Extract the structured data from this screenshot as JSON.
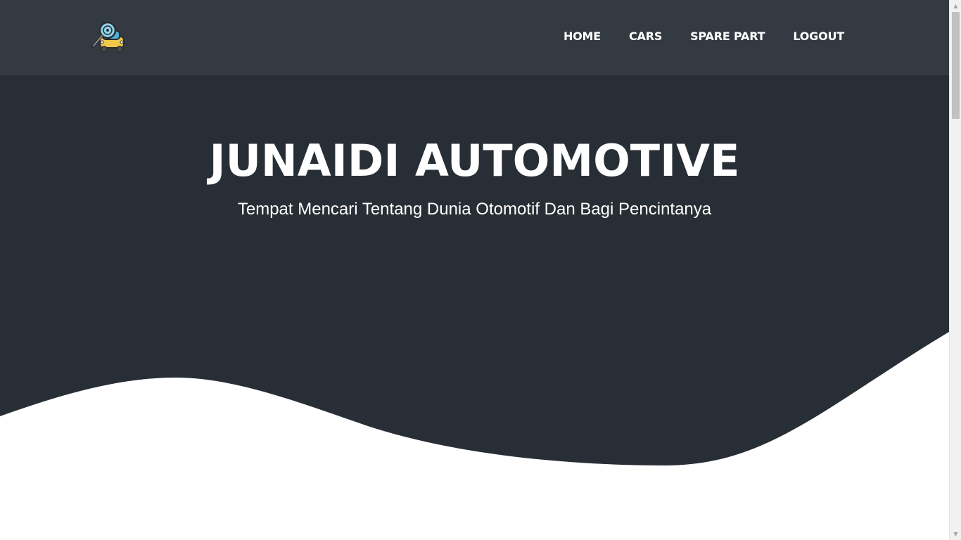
{
  "navbar": {
    "logo_icon": "car-search-logo-icon",
    "links": [
      "HOME",
      "CARS",
      "SPARE PART",
      "LOGOUT"
    ]
  },
  "hero": {
    "title": "JUNAIDI AUTOMOTIVE",
    "subtitle": "Tempat Mencari Tentang Dunia Otomotif Dan Bagi Pencintanya"
  },
  "colors": {
    "navbar_bg": "#343a42",
    "hero_bg": "#282e35",
    "text": "#ffffff",
    "page_bg": "#ffffff"
  },
  "scrollbar": {
    "up_icon": "scroll-up-arrow-icon",
    "down_icon": "scroll-down-arrow-icon"
  }
}
